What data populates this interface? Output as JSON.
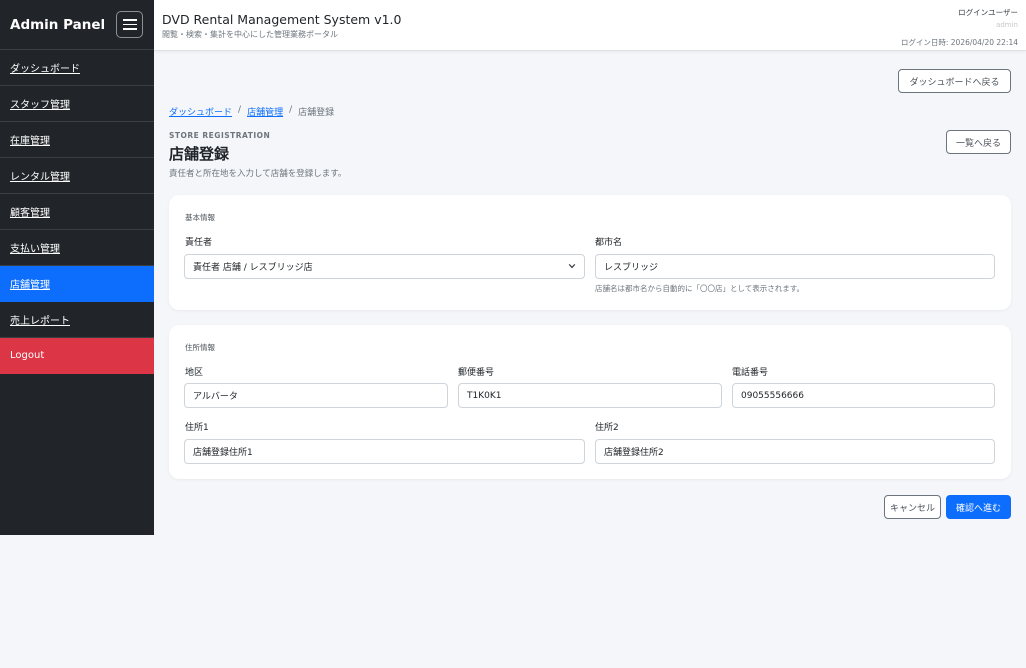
{
  "sidebar": {
    "brand": "Admin Panel",
    "items": [
      {
        "label": "ダッシュボード"
      },
      {
        "label": "スタッフ管理"
      },
      {
        "label": "在庫管理"
      },
      {
        "label": "レンタル管理"
      },
      {
        "label": "顧客管理"
      },
      {
        "label": "支払い管理"
      },
      {
        "label": "店舗管理"
      },
      {
        "label": "売上レポート"
      }
    ],
    "logout": "Logout"
  },
  "header": {
    "title": "DVD Rental Management System v1.0",
    "subtitle": "閲覧・検索・集計を中心にした管理業務ポータル",
    "user_label": "ログインユーザー",
    "user_name": "admin",
    "login_time": "ログイン日時: 2026/04/20 22:14"
  },
  "actions": {
    "back_dashboard": "ダッシュボードへ戻る",
    "back_list": "一覧へ戻る",
    "cancel": "キャンセル",
    "confirm": "確認へ進む"
  },
  "breadcrumb": {
    "dashboard": "ダッシュボード",
    "store_mgmt": "店舗管理",
    "current": "店舗登録",
    "sep": "/"
  },
  "page": {
    "kicker": "STORE REGISTRATION",
    "title": "店舗登録",
    "description": "責任者と所在地を入力して店舗を登録します。"
  },
  "basic": {
    "section": "基本情報",
    "manager_label": "責任者",
    "manager_value": "責任者 店舗 / レスブリッジ店",
    "city_label": "都市名",
    "city_value": "レスブリッジ",
    "city_help": "店舗名は都市名から自動的に「〇〇店」として表示されます。"
  },
  "address": {
    "section": "住所情報",
    "district_label": "地区",
    "district_value": "アルバータ",
    "postal_label": "郵便番号",
    "postal_value": "T1K0K1",
    "phone_label": "電話番号",
    "phone_value": "09055556666",
    "address1_label": "住所1",
    "address1_value": "店舗登録住所1",
    "address2_label": "住所2",
    "address2_value": "店舗登録住所2"
  },
  "colors": {
    "sidebar_bg": "#212529",
    "active": "#0d6efd",
    "logout": "#dc3545",
    "page_bg": "#f4f6f9"
  }
}
